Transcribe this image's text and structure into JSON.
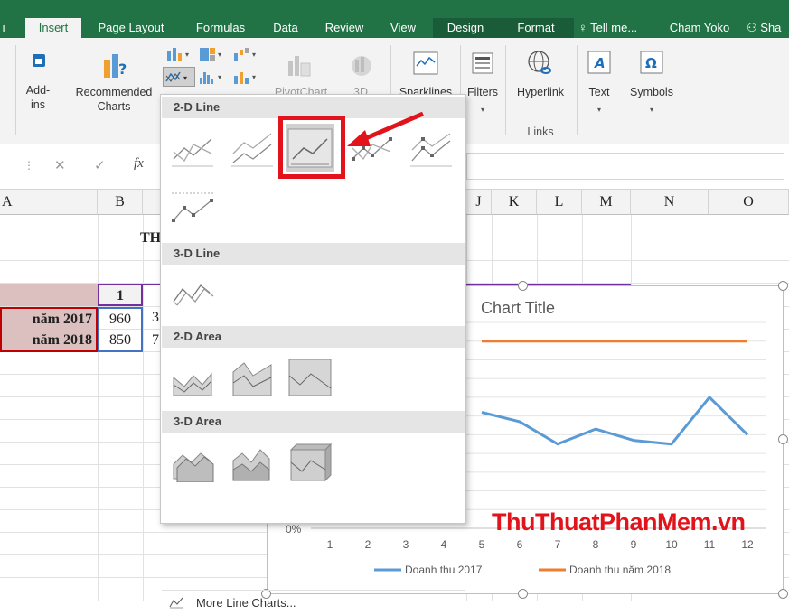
{
  "ribbon": {
    "tabs": [
      "Insert",
      "Page Layout",
      "Formulas",
      "Data",
      "Review",
      "View",
      "Design",
      "Format"
    ],
    "tell_me": "Tell me...",
    "user": "Cham Yoko",
    "share": "Sha",
    "addins": "Add-\nins",
    "recommended_charts": "Recommended\nCharts",
    "pivotchart": "PivotChart",
    "threed": "3D",
    "sparklines": "Sparklines",
    "filters": "Filters",
    "hyperlink": "Hyperlink",
    "links_group": "Links",
    "text": "Text",
    "symbols": "Symbols"
  },
  "formula_bar": {
    "fx": "fx"
  },
  "grid": {
    "columns": [
      "A",
      "B",
      "J",
      "K",
      "L",
      "M",
      "N",
      "O"
    ],
    "title_fragment": "TH",
    "header_cell": "1",
    "row1_label": "năm 2017",
    "row1_value": "960",
    "row1_next": "3",
    "row2_label": "năm 2018",
    "row2_value": "850",
    "row2_next": "7"
  },
  "gallery": {
    "sections": [
      "2-D Line",
      "3-D Line",
      "2-D Area",
      "3-D Area"
    ],
    "more": "More Line Charts..."
  },
  "chart": {
    "title": "Chart Title",
    "y_tick": "0%",
    "watermark": "ThuThuatPhanMem.vn",
    "colors": {
      "series1": "#5b9bd5",
      "series2": "#ed7d31"
    }
  },
  "chart_data": {
    "type": "line",
    "title": "Chart Title",
    "x": [
      1,
      2,
      3,
      4,
      5,
      6,
      7,
      8,
      9,
      10,
      11,
      12
    ],
    "series": [
      {
        "name": "Doanh thu 2017",
        "values": [
          null,
          null,
          null,
          null,
          0.62,
          0.57,
          0.45,
          0.53,
          0.47,
          0.45,
          0.7,
          0.5
        ]
      },
      {
        "name": "Doanh thu năm 2018",
        "values": [
          null,
          null,
          null,
          null,
          1.0,
          1.0,
          1.0,
          1.0,
          1.0,
          1.0,
          1.0,
          1.0
        ]
      }
    ],
    "ylim": [
      0,
      1.1
    ],
    "legend": "bottom",
    "grid": true
  }
}
